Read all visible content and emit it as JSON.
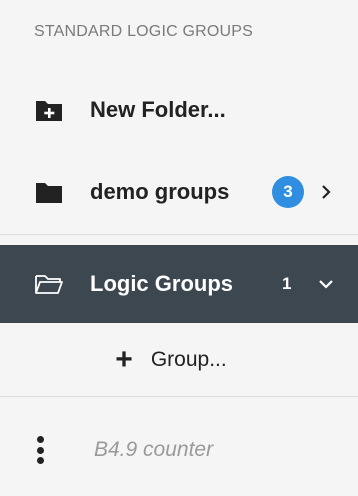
{
  "section": {
    "title": "STANDARD LOGIC GROUPS"
  },
  "items": {
    "new_folder": {
      "label": "New Folder...",
      "icon": "folder-plus-icon"
    },
    "demo_groups": {
      "label": "demo groups",
      "icon": "folder-icon",
      "badge": "3",
      "chevron": "chevron-right-icon"
    },
    "logic_groups": {
      "label": "Logic Groups",
      "icon": "folder-open-icon",
      "count": "1",
      "chevron": "chevron-down-icon",
      "selected": true
    }
  },
  "add_group": {
    "label": "Group...",
    "icon": "plus-icon"
  },
  "logic_item": {
    "label": "B4.9 counter",
    "icon": "kebab-menu-icon"
  },
  "colors": {
    "selected_bg": "#3d4750",
    "badge": "#2f8ee0"
  }
}
